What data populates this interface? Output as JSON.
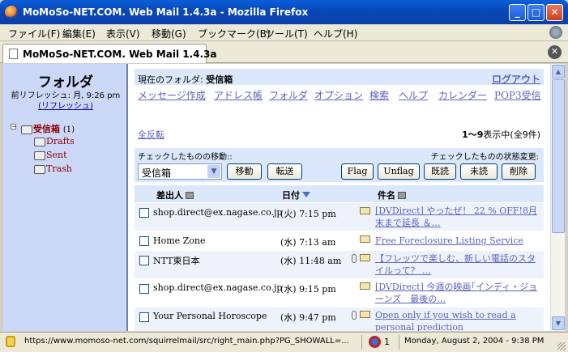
{
  "window": {
    "title": "MoMoSo-NET.COM. Web Mail 1.4.3a - Mozilla Firefox",
    "minimize": "_",
    "maximize": "□",
    "close": "✕"
  },
  "menu": [
    "ファイル(F)",
    "編集(E)",
    "表示(V)",
    "移動(G)",
    "ブックマーク(B)",
    "ツール(T)",
    "ヘルプ(H)"
  ],
  "tab": {
    "title": "MoMoSo-NET.COM. Web Mail 1.4.3a",
    "close": "✕"
  },
  "sidebar": {
    "title": "フォルダ",
    "last_refresh": "前リフレッシュ: 月, 9:26 pm",
    "refresh_link": "(リフレッシュ)",
    "collapse": "−",
    "folders": [
      {
        "name": "受信箱",
        "count": "(1)"
      },
      {
        "name": "Drafts"
      },
      {
        "name": "Sent"
      },
      {
        "name": "Trash"
      }
    ]
  },
  "main": {
    "current_folder_label": "現在のフォルダ: ",
    "current_folder": "受信箱",
    "logout": "ログアウト",
    "nav": [
      "メッセージ作成",
      "アドレス帳",
      "フォルダ",
      "オプション",
      "検索",
      "ヘルプ",
      "カレンダー",
      "POP3受信"
    ],
    "toggle_all": "全反転",
    "range_bold": "1～9",
    "range_text": "表示中(全9件)",
    "move_label": "チェックしたものの移動::",
    "state_label": "チェックしたものの状態変更:",
    "move_select": "受信箱",
    "buttons": {
      "move": "移動",
      "forward": "転送",
      "flag": "Flag",
      "unflag": "Unflag",
      "read": "既読",
      "unread": "未読",
      "delete": "削除"
    },
    "columns": {
      "from": "差出人",
      "date": "日付",
      "subject": "件名"
    },
    "messages": [
      {
        "from": "shop.direct@ex.nagase.co.jp",
        "date": "(火) 7:15 pm",
        "subject": "[DVDirect] やったぜ！ 22 % OFF!8月末まで延長 ＆…"
      },
      {
        "from": "Home Zone",
        "date": "(水) 7:13 am",
        "subject": "Free Foreclosure Listing Service"
      },
      {
        "from": "NTT東日本",
        "date": "(水) 11:48 am",
        "subject": "【フレッツで楽しむ、新しい電話のスタイルって？ …"
      },
      {
        "from": "shop.direct@ex.nagase.co.jp",
        "date": "(水) 9:15 pm",
        "subject": "[DVDirect] 今週の映画｢インディ・ジョーンズ　最後の…"
      },
      {
        "from": "Your Personal Horoscope",
        "date": "(水) 9:47 pm",
        "subject": "Open only if you wish to read a personal prediction"
      }
    ]
  },
  "status": {
    "url": "https://www.momoso-net.com/squirrelmail/src/right_main.php?PG_SHOWALL=...",
    "blocked_count": "1",
    "datetime": "Monday, August 2, 2004 - 9:38 PM"
  },
  "scrollbar": {
    "up": "▲",
    "down": "▼"
  }
}
